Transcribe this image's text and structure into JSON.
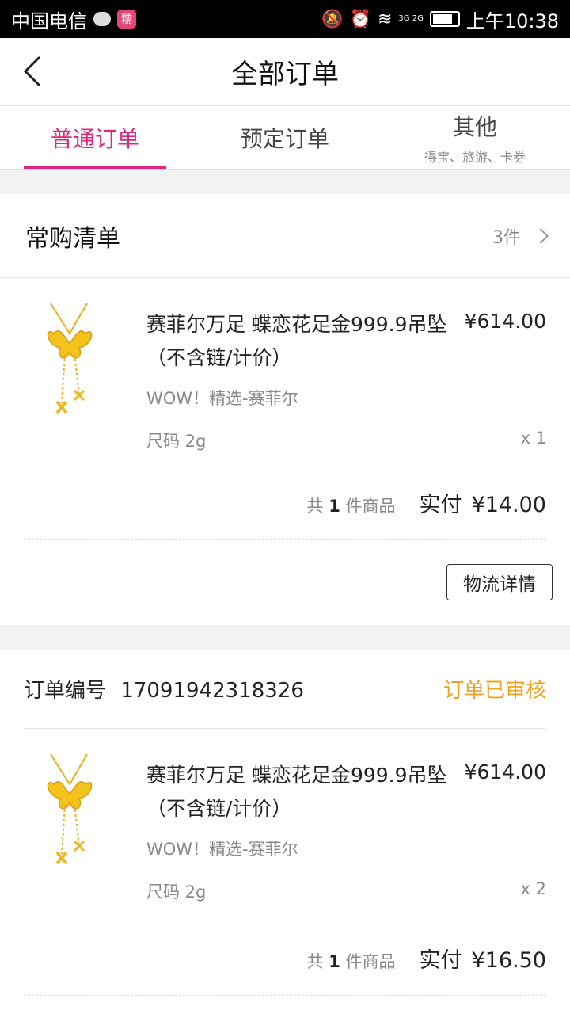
{
  "status_bar": {
    "carrier": "中国电信",
    "app_badge": "糯",
    "network": "3G 2G",
    "time": "上午10:38"
  },
  "header": {
    "title": "全部订单"
  },
  "tabs": [
    {
      "label": "普通订单",
      "active": true
    },
    {
      "label": "预定订单",
      "active": false
    },
    {
      "label": "其他",
      "sub": "得宝、旅游、卡券",
      "active": false
    }
  ],
  "frequent_list": {
    "title": "常购清单",
    "count": "3件",
    "item": {
      "name": "赛菲尔万足 蝶恋花足金999.9吊坠（不含链/计价）",
      "price": "¥614.00",
      "shop": "WOW！精选-赛菲尔",
      "size": "尺码 2g",
      "qty": "x 1"
    },
    "summary": {
      "prefix": "共",
      "count": "1",
      "suffix": "件商品",
      "paid_label": "实付",
      "paid_amount": "¥14.00"
    },
    "logistics_button": "物流详情"
  },
  "order": {
    "number_label": "订单编号",
    "number": "17091942318326",
    "status": "订单已审核",
    "item": {
      "name": "赛菲尔万足 蝶恋花足金999.9吊坠（不含链/计价）",
      "price": "¥614.00",
      "shop": "WOW！精选-赛菲尔",
      "size": "尺码 2g",
      "qty": "x 2"
    },
    "summary": {
      "prefix": "共",
      "count": "1",
      "suffix": "件商品",
      "paid_label": "实付",
      "paid_amount": "¥16.50"
    }
  },
  "colors": {
    "accent": "#e0257a",
    "status_orange": "#f0a21f",
    "background": "#f2f2f2"
  }
}
